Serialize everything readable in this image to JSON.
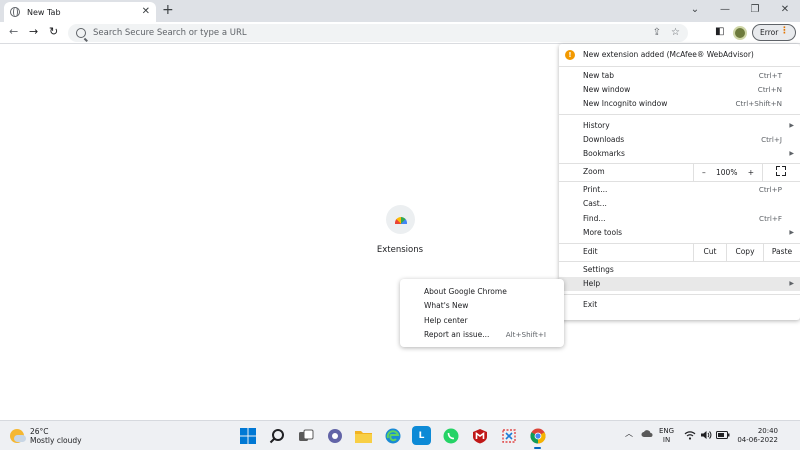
{
  "tab": {
    "title": "New Tab",
    "close": "✕",
    "new_tab": "+"
  },
  "window_controls": {
    "minimize": "⌄",
    "minimize2": "—",
    "restore": "❐",
    "close": "✕"
  },
  "toolbar": {
    "back": "←",
    "forward": "→",
    "reload": "↻",
    "omnibox_placeholder": "Search Secure Search or type a URL",
    "share": "⇪",
    "bookmark": "☆",
    "sidepanel": "◧",
    "error_label": "Error",
    "menu_dots": "⋮"
  },
  "page": {
    "extensions_label": "Extensions"
  },
  "menu": {
    "notice": "New extension added (McAfee® WebAdvisor)",
    "items": [
      {
        "label": "New tab",
        "shortcut": "Ctrl+T"
      },
      {
        "label": "New window",
        "shortcut": "Ctrl+N"
      },
      {
        "label": "New Incognito window",
        "shortcut": "Ctrl+Shift+N"
      },
      {
        "label": "History",
        "arrow": "▶"
      },
      {
        "label": "Downloads",
        "shortcut": "Ctrl+J"
      },
      {
        "label": "Bookmarks",
        "arrow": "▶"
      },
      {
        "label": "Zoom"
      },
      {
        "label": "Print...",
        "shortcut": "Ctrl+P"
      },
      {
        "label": "Cast..."
      },
      {
        "label": "Find...",
        "shortcut": "Ctrl+F"
      },
      {
        "label": "More tools",
        "arrow": "▶"
      },
      {
        "label": "Edit"
      },
      {
        "label": "Settings"
      },
      {
        "label": "Help",
        "arrow": "▶"
      },
      {
        "label": "Exit"
      }
    ],
    "zoom": {
      "minus": "–",
      "value": "100%",
      "plus": "+"
    },
    "edit": {
      "cut": "Cut",
      "copy": "Copy",
      "paste": "Paste"
    }
  },
  "help_submenu": {
    "items": [
      {
        "label": "About Google Chrome"
      },
      {
        "label": "What's New"
      },
      {
        "label": "Help center"
      },
      {
        "label": "Report an issue...",
        "shortcut": "Alt+Shift+I"
      }
    ]
  },
  "taskbar": {
    "weather_temp": "26°C",
    "weather_cond": "Mostly cloudy",
    "lang_1": "ENG",
    "lang_2": "IN",
    "time": "20:40",
    "date": "04-06-2022",
    "tray_chevron": "︿"
  }
}
